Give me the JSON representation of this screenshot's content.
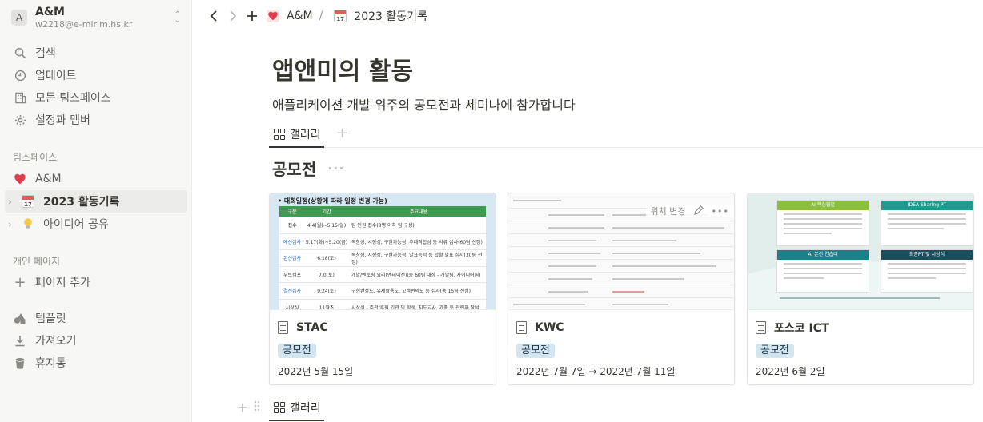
{
  "workspace": {
    "avatar_letter": "A",
    "name": "A&M",
    "email": "w2218@e-mirim.hs.kr"
  },
  "sidebar": {
    "top_items": [
      {
        "label": "검색",
        "icon": "search-icon"
      },
      {
        "label": "업데이트",
        "icon": "clock-icon"
      },
      {
        "label": "모든 팀스페이스",
        "icon": "building-icon"
      },
      {
        "label": "설정과 멤버",
        "icon": "gear-icon"
      }
    ],
    "teamspace_label": "팀스페이스",
    "teamspace_items": [
      {
        "label": "A&M",
        "icon": "heart-icon"
      },
      {
        "label": "2023 활동기록",
        "icon": "calendar-icon",
        "selected": true
      },
      {
        "label": "아이디어 공유",
        "icon": "lightbulb-icon"
      }
    ],
    "personal_label": "개인 페이지",
    "add_page_label": "페이지 추가",
    "bottom_items": [
      {
        "label": "템플릿",
        "icon": "shapes-icon"
      },
      {
        "label": "가져오기",
        "icon": "download-icon"
      },
      {
        "label": "휴지통",
        "icon": "trash-icon"
      }
    ]
  },
  "topbar": {
    "breadcrumb_root": "A&M",
    "breadcrumb_sep": "/",
    "breadcrumb_page": "2023 활동기록"
  },
  "page": {
    "title": "앱앤미의 활동",
    "description": "애플리케이션 개발 위주의 공모전과 세미나에 참가합니다"
  },
  "view": {
    "tab_label": "갤러리",
    "add_symbol": "+"
  },
  "group": {
    "title": "공모전",
    "more": "···"
  },
  "cards": [
    {
      "title": "STAC",
      "tag": "공모전",
      "date": "2022년 5월 15일"
    },
    {
      "title": "KWC",
      "tag": "공모전",
      "date": "2022년 7월 7일 → 2022년 7월 11일"
    },
    {
      "title": "포스코 ICT",
      "tag": "공모전",
      "date": "2022년 6월 2일"
    }
  ],
  "card_overlay": {
    "reposition_label": "위치 변경",
    "more": "•••"
  },
  "cover_stac": {
    "heading": "• 대회일정(상황에 따라 일정 변경 가능)",
    "header_row": [
      "구분",
      "기간",
      "주요내용"
    ],
    "rows": [
      [
        "접수",
        "4.4(월)~5.15(일)",
        "팀 인원 접수(3명 이하 팀 구성)"
      ],
      [
        "예선심사",
        "5.17(화)~5.20(금)",
        "독창성, 시장성, 구현가능성, 주제적합성 등 서류 심사(60팀 선정)"
      ],
      [
        "본선심사",
        "6.18(토)",
        "독창성, 시장성, 구현가능성, 발표능력 등 탑활 발표 심사(30팀 선정)"
      ],
      [
        "부트캠프",
        "7.0(토)",
        "개발/멘토링 요리(멘테이션)(총 60팀 대상 - 개발팀, 자이디어팀)"
      ],
      [
        "결선심사",
        "9.24(토)",
        "구현완성도, 유제활용도, 고객편의도 등 심사(총 15팀 선정)"
      ],
      [
        "시상식",
        "11월초",
        "시상식 - 주관/후원 기관 및 학생, 지도교사, 가족 등 관련자 참석"
      ]
    ]
  },
  "cover_posco": {
    "boxes": [
      "AI 핵심협업",
      "IDEA Sharing PT",
      "AI 본선 연습대",
      "최종PT 및 시상식"
    ]
  }
}
